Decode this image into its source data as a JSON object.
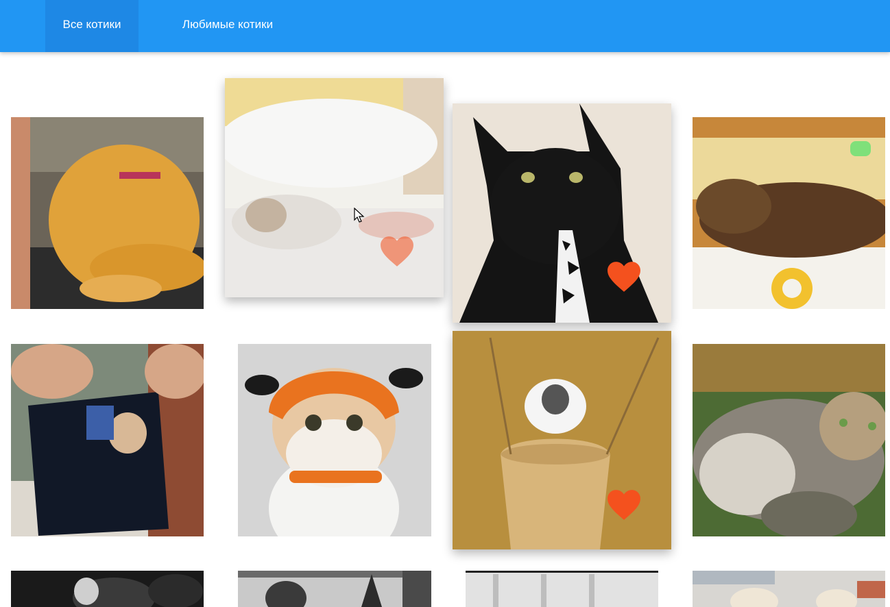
{
  "nav": {
    "tabs": [
      {
        "label": "Все котики",
        "active": true
      },
      {
        "label": "Любимые котики",
        "active": false
      }
    ]
  },
  "colors": {
    "header": "#2196f3",
    "active_tab": "#1e88e5",
    "heart": "#f4511e"
  },
  "cats": [
    {
      "name": "orange-cat",
      "favorite": false
    },
    {
      "name": "white-cat-under-pillow",
      "favorite": true,
      "hover": true
    },
    {
      "name": "black-cat-in-tie",
      "favorite": true
    },
    {
      "name": "brown-cat-sleeping",
      "favorite": false
    },
    {
      "name": "kitten-in-backpack",
      "favorite": false
    },
    {
      "name": "cat-in-pumpkin-hat",
      "favorite": false
    },
    {
      "name": "kitten-in-basket",
      "favorite": true
    },
    {
      "name": "fluffy-tabby-cat",
      "favorite": false
    },
    {
      "name": "black-white-cat",
      "favorite": false
    },
    {
      "name": "kitten-bw-photo",
      "favorite": false
    },
    {
      "name": "cat-gray-photo",
      "favorite": false
    },
    {
      "name": "siamese-kittens",
      "favorite": false
    }
  ]
}
